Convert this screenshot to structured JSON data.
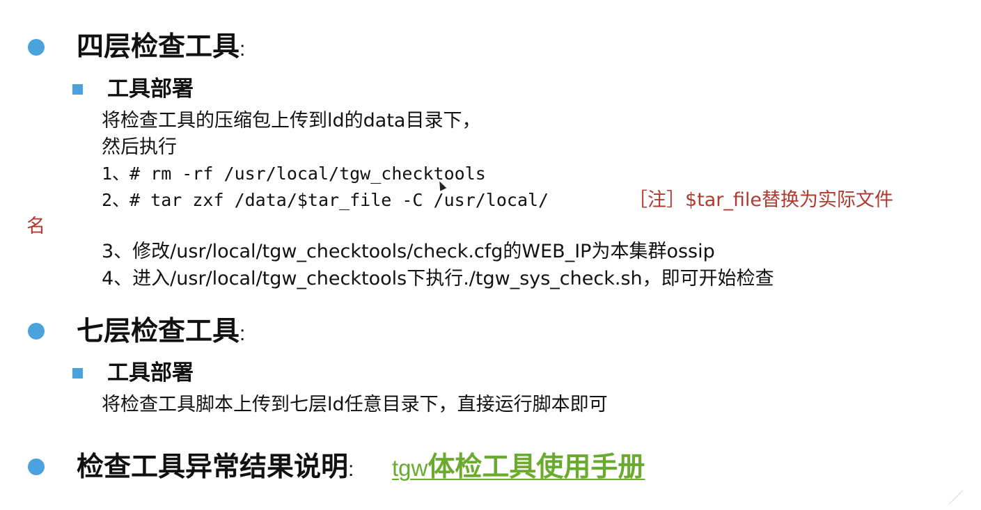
{
  "section1": {
    "title": "四层检查工具",
    "colon": ":",
    "subtitle": "工具部署",
    "line1": "将检查工具的压缩包上传到ld的data目录下，",
    "line2": "然后执行",
    "step1": "1、# rm -rf /usr/local/tgw_checktools",
    "step2": "2、# tar zxf /data/$tar_file -C /usr/local/",
    "note_line1": "［注］$tar_file替换为实际文件",
    "note_line2": "名",
    "step3": "3、修改/usr/local/tgw_checktools/check.cfg的WEB_IP为本集群ossip",
    "step4": "4、进入/usr/local/tgw_checktools下执行./tgw_sys_check.sh，即可开始检查"
  },
  "section2": {
    "title": "七层检查工具",
    "colon": ":",
    "subtitle": "工具部署",
    "line1": "将检查工具脚本上传到七层ld任意目录下，直接运行脚本即可"
  },
  "section3": {
    "title": "检查工具异常结果说明",
    "colon": ":",
    "link_prefix": "tgw",
    "link_main": "体检工具使用手册"
  },
  "colors": {
    "bullet": "#4aa3df",
    "note": "#b03a2e",
    "link": "#6aaa2e"
  }
}
